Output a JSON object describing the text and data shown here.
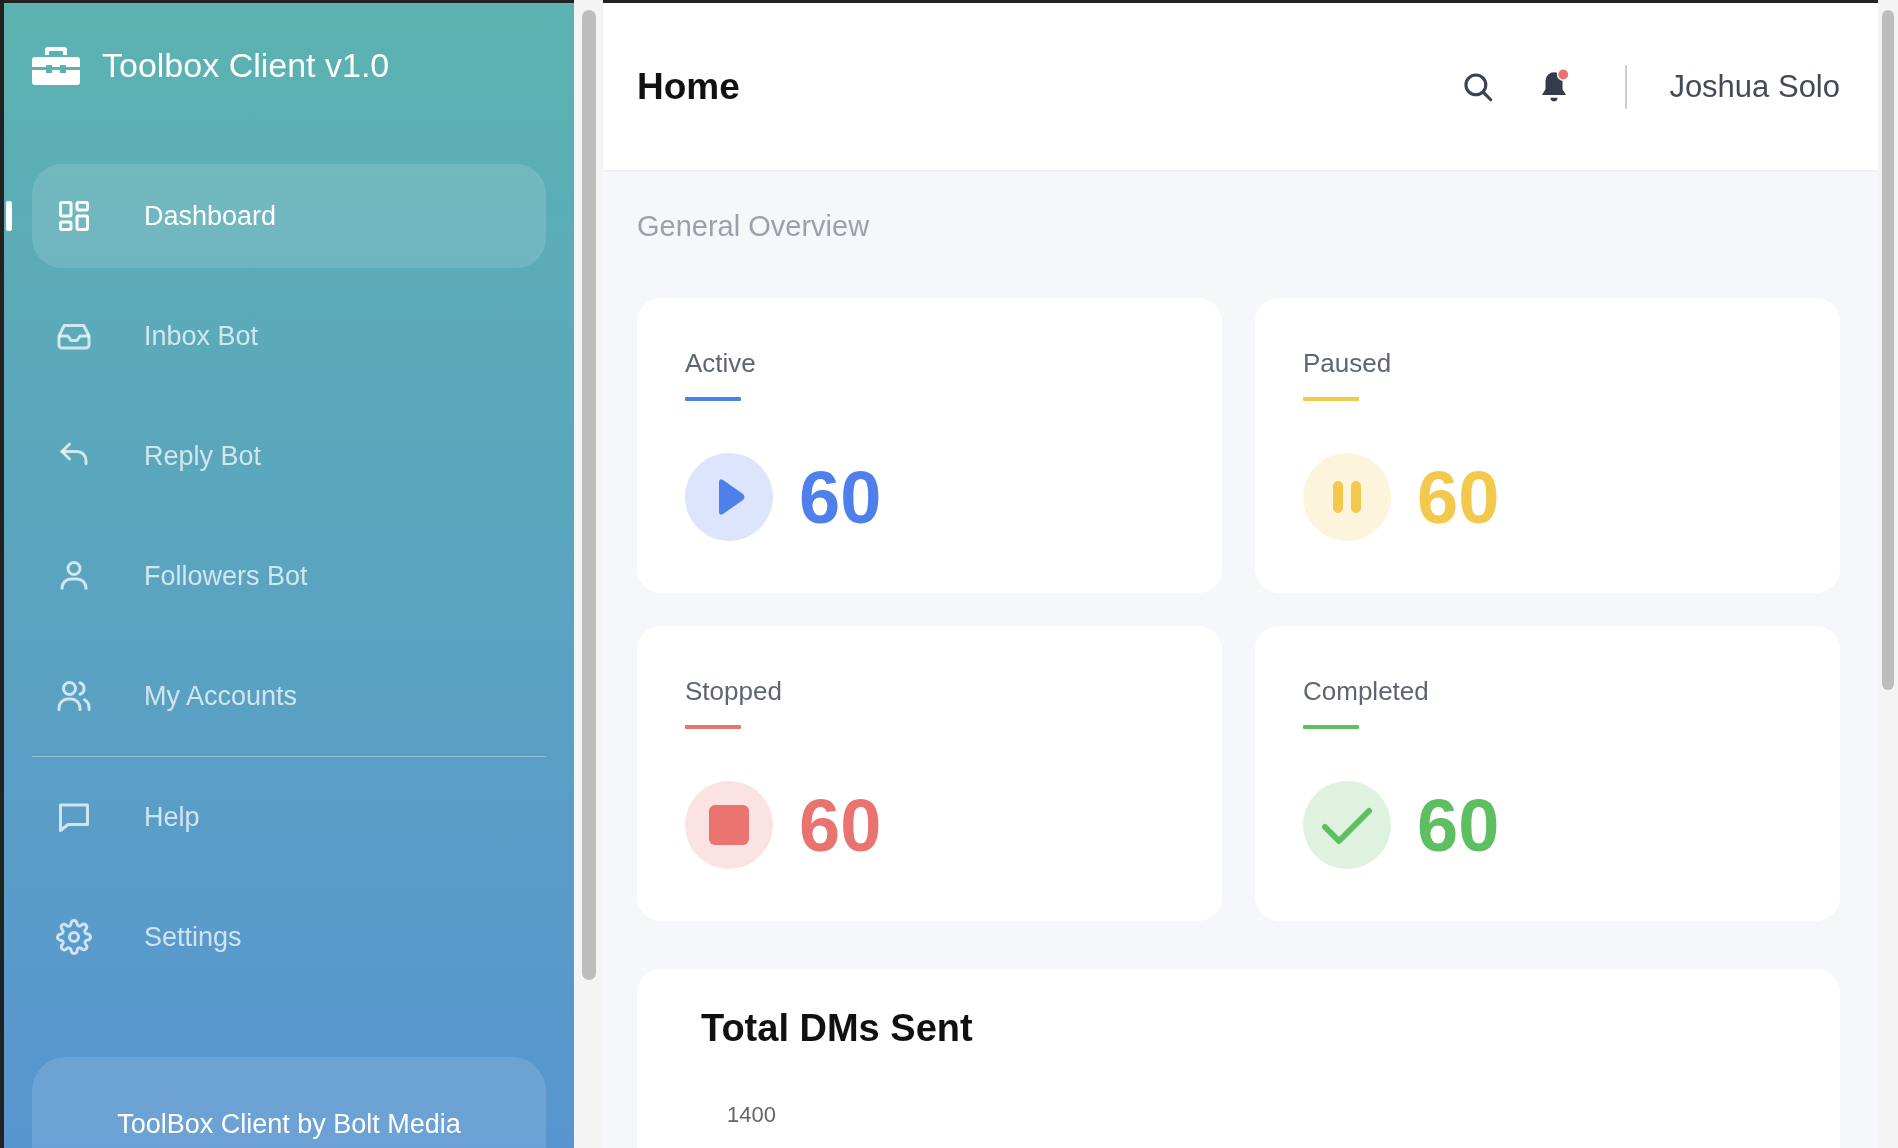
{
  "sidebar": {
    "title": "Toolbox Client v1.0",
    "items": [
      {
        "label": "Dashboard",
        "kind": "grid",
        "selected": true
      },
      {
        "label": "Inbox Bot",
        "kind": "inbox",
        "selected": false
      },
      {
        "label": "Reply Bot",
        "kind": "reply",
        "selected": false
      },
      {
        "label": "Followers Bot",
        "kind": "user",
        "selected": false
      },
      {
        "label": "My Accounts",
        "kind": "users",
        "selected": false
      }
    ],
    "secondary_items": [
      {
        "label": "Help",
        "kind": "chat",
        "selected": false
      },
      {
        "label": "Settings",
        "kind": "gear",
        "selected": false
      }
    ],
    "footer": "ToolBox Client by Bolt Media"
  },
  "header": {
    "title": "Home",
    "notification": true,
    "user": "Joshua Solo"
  },
  "section_title": "General Overview",
  "stats": [
    {
      "label": "Active",
      "value": "60",
      "kind": "play",
      "color": "#4f7fea"
    },
    {
      "label": "Paused",
      "value": "60",
      "kind": "pause",
      "color": "#f2c94c"
    },
    {
      "label": "Stopped",
      "value": "60",
      "kind": "stop",
      "color": "#e8736f"
    },
    {
      "label": "Completed",
      "value": "60",
      "kind": "check",
      "color": "#5dbe62"
    }
  ],
  "chart_card": {
    "title": "Total DMs Sent",
    "axis_labels": [
      "1400"
    ]
  }
}
